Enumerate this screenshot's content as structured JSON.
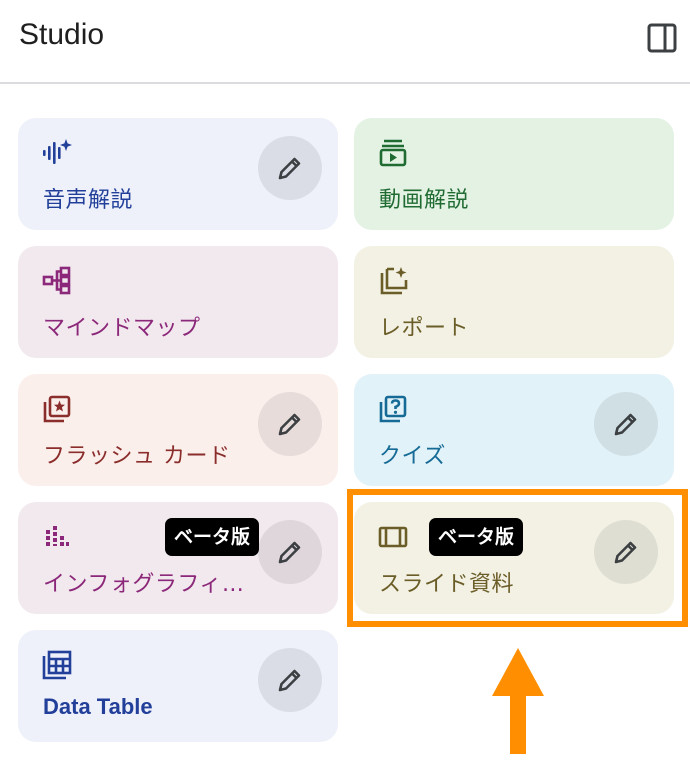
{
  "header": {
    "title": "Studio",
    "panel_icon": "side-panel-icon"
  },
  "cards": {
    "audio": {
      "label": "音声解説",
      "icon": "audio-waveform-sparkle-icon",
      "color": "#22409a",
      "bg": "#eef0fa"
    },
    "video": {
      "label": "動画解説",
      "icon": "video-stack-icon",
      "color": "#1f6b32",
      "bg": "#e4f2e4"
    },
    "mindmap": {
      "label": "マインドマップ",
      "icon": "mind-map-icon",
      "color": "#8c2879",
      "bg": "#f2e9ef"
    },
    "report": {
      "label": "レポート",
      "icon": "report-sparkle-icon",
      "color": "#6b5d27",
      "bg": "#f2f1e4"
    },
    "flashcards": {
      "label": "フラッシュ カード",
      "icon": "flashcards-star-icon",
      "color": "#8a2d2b",
      "bg": "#fbefec"
    },
    "quiz": {
      "label": "クイズ",
      "icon": "quiz-question-icon",
      "color": "#156a96",
      "bg": "#e1f2f8"
    },
    "infographic": {
      "label": "インフォグラフィ…",
      "icon": "infographic-bars-icon",
      "color": "#8c2879",
      "bg": "#f2e9ef",
      "badge": "ベータ版"
    },
    "slides": {
      "label": "スライド資料",
      "icon": "slides-icon",
      "color": "#6b5d27",
      "bg": "#f2f1e4",
      "badge": "ベータ版"
    },
    "datatable": {
      "label": "Data Table",
      "icon": "table-grid-icon",
      "color": "#22409a",
      "bg": "#eef0fa"
    }
  },
  "edit_icon": "pencil-icon",
  "annotation": {
    "highlight_color": "#ff8f00",
    "arrow_icon": "up-arrow-icon"
  }
}
